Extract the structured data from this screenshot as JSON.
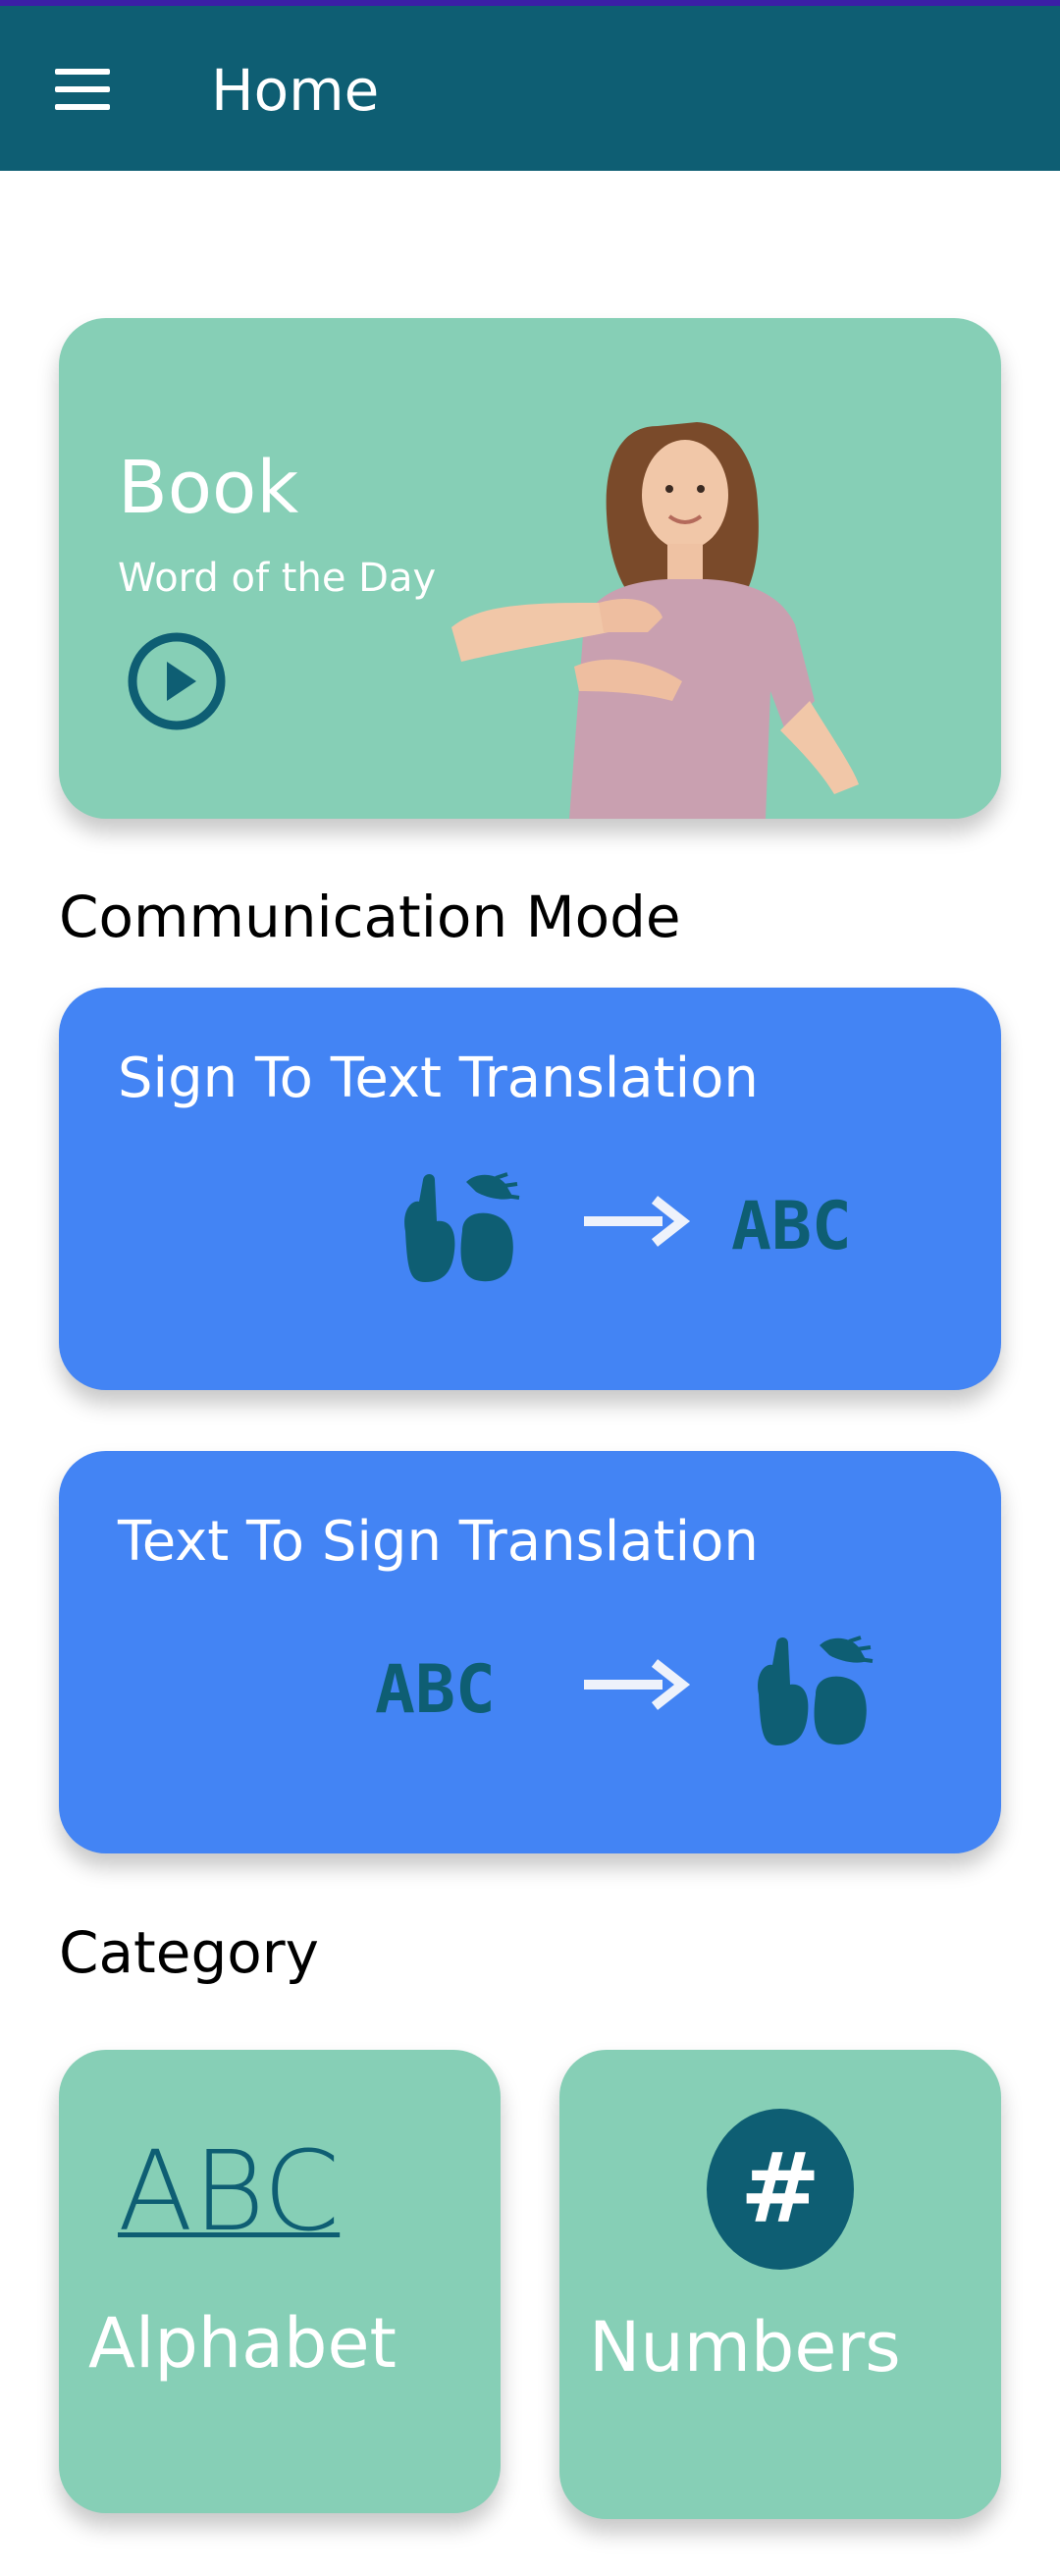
{
  "app_bar": {
    "title": "Home",
    "menu_icon": "hamburger-menu-icon",
    "background": "#0e5e73"
  },
  "word_of_day": {
    "word": "Book",
    "subtitle": "Word of the Day",
    "play_icon": "play-circle-icon",
    "background": "#86cfb6"
  },
  "communication": {
    "heading": "Communication Mode",
    "cards": [
      {
        "label": "Sign To Text Translation",
        "icons": [
          "sign-hands-icon",
          "arrow-right-icon",
          "abc-text-icon"
        ],
        "abc_text": "ABC"
      },
      {
        "label": "Text To Sign Translation",
        "icons": [
          "abc-text-icon",
          "arrow-right-icon",
          "sign-hands-icon"
        ],
        "abc_text": "ABC"
      }
    ],
    "card_color": "#4384f4"
  },
  "category": {
    "heading": "Category",
    "items": [
      {
        "label": "Alphabet",
        "logo_text": "ABC"
      },
      {
        "label": "Numbers",
        "logo_text": "#"
      }
    ],
    "card_color": "#86cfb6"
  }
}
